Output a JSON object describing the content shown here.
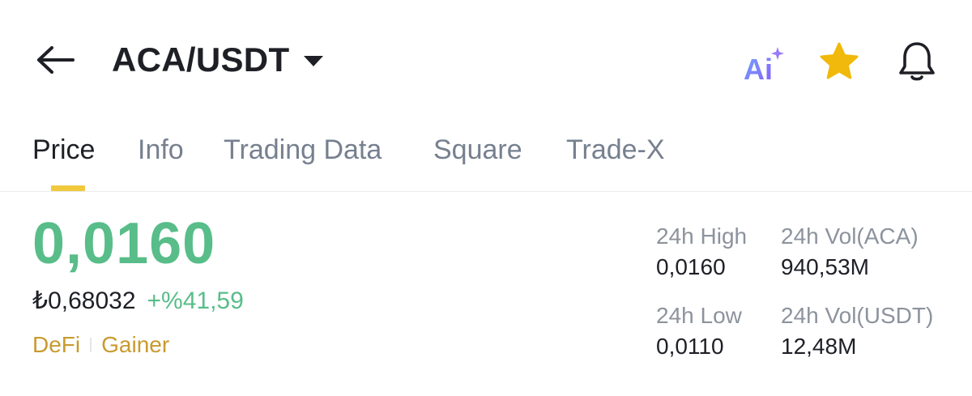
{
  "header": {
    "pair": "ACA/USDT",
    "ai_label": "Ai"
  },
  "tabs": [
    {
      "label": "Price",
      "active": true
    },
    {
      "label": "Info",
      "active": false
    },
    {
      "label": "Trading Data",
      "active": false
    },
    {
      "label": "Square",
      "active": false
    },
    {
      "label": "Trade-X",
      "active": false
    }
  ],
  "price": {
    "last": "0,0160",
    "fiat": "₺0,68032",
    "change": "+%41,59"
  },
  "tags": [
    "DeFi",
    "Gainer"
  ],
  "stats": {
    "high_label": "24h High",
    "high_value": "0,0160",
    "low_label": "24h Low",
    "low_value": "0,0110",
    "vol_base_label": "24h Vol(ACA)",
    "vol_base_value": "940,53M",
    "vol_quote_label": "24h Vol(USDT)",
    "vol_quote_value": "12,48M"
  },
  "colors": {
    "up_green": "#58bd89",
    "star_gold": "#f0b90b",
    "tab_indicator": "#f0c93c",
    "tag_gold": "#c99a2e"
  },
  "icons": [
    "back-arrow-icon",
    "chevron-down-icon",
    "ai-icon",
    "star-icon",
    "bell-icon"
  ]
}
